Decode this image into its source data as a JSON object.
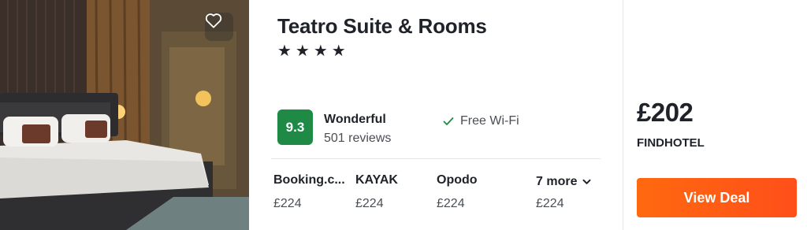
{
  "hotel": {
    "name": "Teatro Suite & Rooms",
    "stars": "★★★★",
    "photo_icon": "hotel-room-photo"
  },
  "rating": {
    "score": "9.3",
    "label": "Wonderful",
    "reviews": "501 reviews",
    "color": "#1f8a46"
  },
  "amenity": {
    "label": "Free Wi-Fi",
    "icon": "check-icon"
  },
  "providers": [
    {
      "name": "Booking.c...",
      "price": "£224"
    },
    {
      "name": "KAYAK",
      "price": "£224"
    },
    {
      "name": "Opodo",
      "price": "£224"
    }
  ],
  "more": {
    "label": "7 more",
    "price": "£224",
    "icon": "chevron-down-icon"
  },
  "deal": {
    "price": "£202",
    "seller": "FINDHOTEL",
    "button_label": "View Deal",
    "button_color": "#ff5b14"
  },
  "favorite_icon": "heart-icon"
}
